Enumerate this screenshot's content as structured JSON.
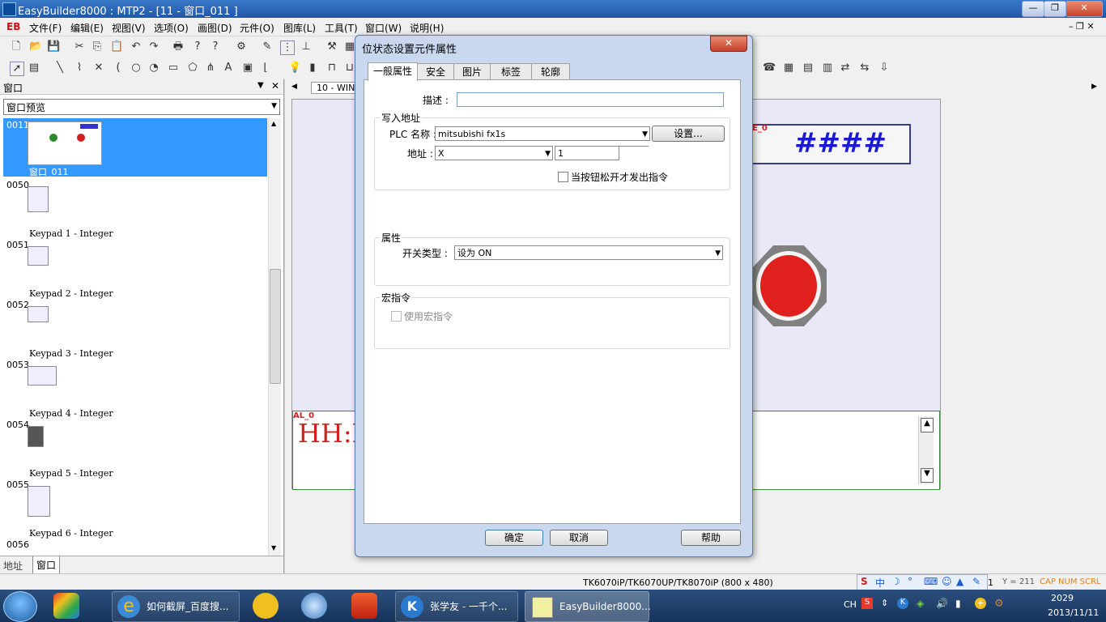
{
  "window": {
    "title": "EasyBuilder8000 : MTP2 - [11 - 窗口_011 ]",
    "min_label": "—",
    "max_label": "❐",
    "close_label": "✕"
  },
  "menu": {
    "logo": "EB",
    "items": [
      "文件(F)",
      "编辑(E)",
      "视图(V)",
      "选项(O)",
      "画图(D)",
      "元件(O)",
      "图库(L)",
      "工具(T)",
      "窗口(W)",
      "说明(H)"
    ]
  },
  "left_panel": {
    "header": "窗口",
    "select_value": "窗口预览",
    "items": [
      {
        "num": "0011",
        "name": "窗口_011"
      },
      {
        "num": "0050",
        "name": "Keypad 1 - Integer"
      },
      {
        "num": "0051",
        "name": "Keypad 2 - Integer"
      },
      {
        "num": "0052",
        "name": "Keypad 3 - Integer"
      },
      {
        "num": "0053",
        "name": "Keypad 4 - Integer"
      },
      {
        "num": "0054",
        "name": "Keypad 5 - Integer"
      },
      {
        "num": "0055",
        "name": "Keypad 6 - Integer"
      },
      {
        "num": "0056",
        "name": ""
      }
    ],
    "tabs": [
      "地址",
      "窗口"
    ]
  },
  "editor": {
    "tab_label": "10 - WIN",
    "numeric_display": "####",
    "numeric_label": "E_0",
    "alarm_label": "AL_0",
    "alarm_text": "HH:M"
  },
  "dialog": {
    "title": "位状态设置元件属性",
    "tabs": [
      "一般属性",
      "安全",
      "图片",
      "标签",
      "轮廓"
    ],
    "description_label": "描述 :",
    "description_value": "",
    "write_group": "写入地址",
    "plc_name_label": "PLC 名称 :",
    "plc_name_value": "mitsubishi fx1s",
    "settings_button": "设置...",
    "address_label": "地址 :",
    "address_type": "X",
    "address_value": "1",
    "release_checkbox": "当按钮松开才发出指令",
    "attr_group": "属性",
    "switch_type_label": "开关类型 :",
    "switch_type_value": "设为 ON",
    "macro_group": "宏指令",
    "macro_checkbox": "使用宏指令",
    "ok_button": "确定",
    "cancel_button": "取消",
    "help_button": "帮助"
  },
  "status_bar": {
    "model": "TK6070iP/TK6070UP/TK8070iP (800 x 480)",
    "page": "1",
    "coords": "Y = 211",
    "caps": "CAP NUM SCRL"
  },
  "taskbar": {
    "tasks": [
      "如何截屏_百度搜...",
      "张学友 - 一千个...",
      "EasyBuilder8000..."
    ],
    "tray_lang": "CH",
    "time": "2029",
    "date": "2013/11/11"
  }
}
